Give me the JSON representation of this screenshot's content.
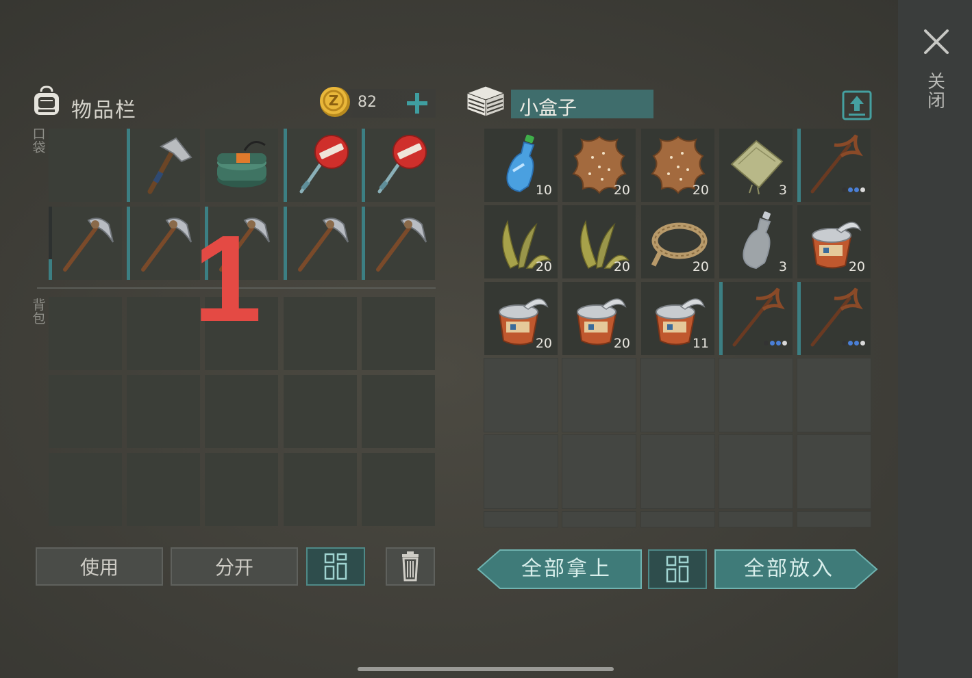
{
  "side_panel": {
    "close_label": "关闭"
  },
  "inventory": {
    "title": "物品栏",
    "coins": "82",
    "pocket_label": "口袋",
    "backpack_label": "背包",
    "pocket_slots": [
      {
        "item": "",
        "qty": ""
      },
      {
        "item": "hatchet-icon",
        "qty": ""
      },
      {
        "item": "c4-explosive-icon",
        "qty": ""
      },
      {
        "item": "stop-sign-axe-icon",
        "qty": ""
      },
      {
        "item": "stop-sign-axe-icon",
        "qty": ""
      },
      {
        "item": "pickaxe-icon",
        "qty": ""
      },
      {
        "item": "pickaxe-icon",
        "qty": ""
      },
      {
        "item": "pickaxe-icon",
        "qty": ""
      },
      {
        "item": "pickaxe-icon",
        "qty": ""
      },
      {
        "item": "pickaxe-icon",
        "qty": ""
      }
    ],
    "overlay_number": "1",
    "buttons": {
      "use": "使用",
      "split": "分开"
    }
  },
  "container": {
    "title": "小盒子",
    "slots": [
      {
        "item": "water-bottle-icon",
        "qty": "10"
      },
      {
        "item": "leather-hide-icon",
        "qty": "20"
      },
      {
        "item": "leather-hide-icon",
        "qty": "20"
      },
      {
        "item": "cloth-icon",
        "qty": "3"
      },
      {
        "item": "wooden-pickaxe-icon",
        "qty": ""
      },
      {
        "item": "plant-fiber-icon",
        "qty": "20"
      },
      {
        "item": "plant-fiber-icon",
        "qty": "20"
      },
      {
        "item": "rope-icon",
        "qty": "20"
      },
      {
        "item": "empty-bottle-icon",
        "qty": "3"
      },
      {
        "item": "tin-can-icon",
        "qty": "20"
      },
      {
        "item": "tin-can-icon",
        "qty": "20"
      },
      {
        "item": "tin-can-icon",
        "qty": "20"
      },
      {
        "item": "tin-can-icon",
        "qty": "11"
      },
      {
        "item": "wooden-pickaxe-icon",
        "qty": ""
      },
      {
        "item": "wooden-pickaxe-icon",
        "qty": ""
      }
    ],
    "buttons": {
      "take_all": "全部拿上",
      "put_all": "全部放入"
    }
  },
  "colors": {
    "accent": "#3c7f83",
    "teal_button": "#3f7b79",
    "overlay_red": "#e44a44"
  }
}
